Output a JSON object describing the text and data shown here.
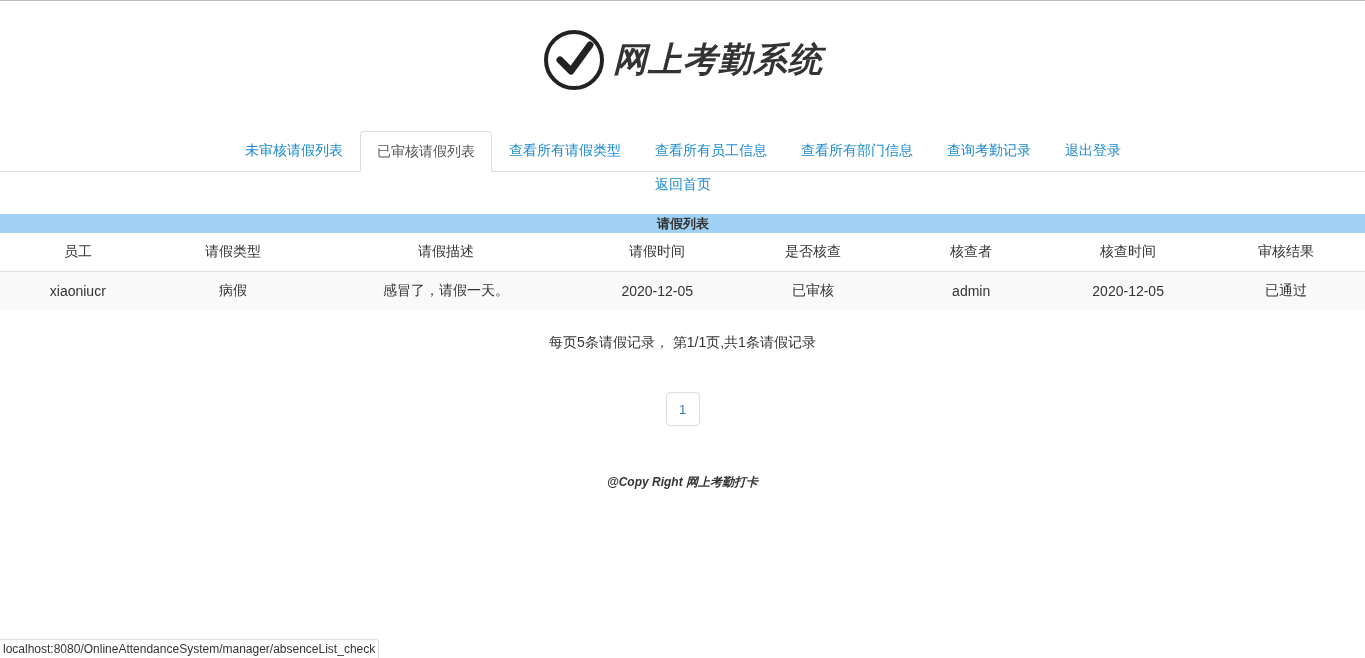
{
  "header": {
    "title": "网上考勤系统"
  },
  "tabs": [
    {
      "label": "未审核请假列表",
      "selected": false
    },
    {
      "label": "已审核请假列表",
      "selected": true
    },
    {
      "label": "查看所有请假类型",
      "selected": false
    },
    {
      "label": "查看所有员工信息",
      "selected": false
    },
    {
      "label": "查看所有部门信息",
      "selected": false
    },
    {
      "label": "查询考勤记录",
      "selected": false
    },
    {
      "label": "退出登录",
      "selected": false
    }
  ],
  "back_link": "返回首页",
  "table": {
    "caption": "请假列表",
    "columns": [
      "员工",
      "请假类型",
      "请假描述",
      "请假时间",
      "是否核查",
      "核查者",
      "核查时间",
      "审核结果"
    ],
    "rows": [
      [
        "xiaoniucr",
        "病假",
        "感冒了，请假一天。",
        "2020-12-05",
        "已审核",
        "admin",
        "2020-12-05",
        "已通过"
      ]
    ]
  },
  "summary": "每页5条请假记录， 第1/1页,共1条请假记录",
  "pagination": [
    {
      "label": "1",
      "selected": true
    }
  ],
  "footer": "@Copy Right 网上考勤打卡",
  "status_bar": "localhost:8080/OnlineAttendanceSystem/manager/absenceList_check"
}
